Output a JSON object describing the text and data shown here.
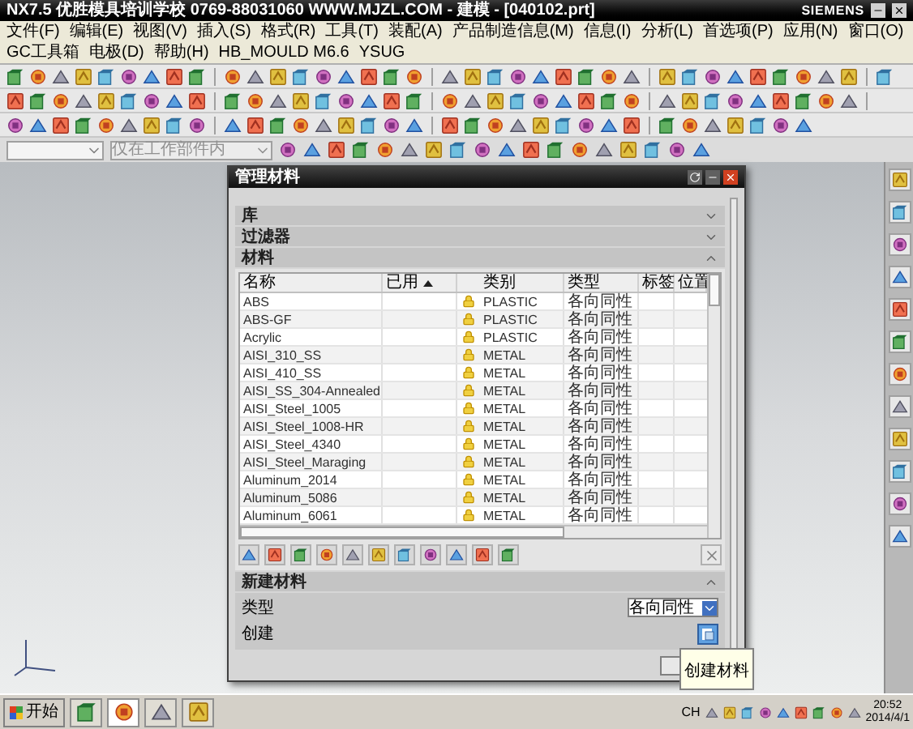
{
  "title_bar": {
    "title": "NX7.5  优胜模具培训学校  0769-88031060  WWW.MJZL.COM - 建模 - [040102.prt]",
    "brand": "SIEMENS"
  },
  "menu_bar": [
    "文件(F)",
    "编辑(E)",
    "视图(V)",
    "插入(S)",
    "格式(R)",
    "工具(T)",
    "装配(A)",
    "产品制造信息(M)",
    "信息(I)",
    "分析(L)",
    "首选项(P)",
    "应用(N)",
    "窗口(O)",
    "GC工具箱",
    "电极(D)",
    "帮助(H)",
    "HB_MOULD M6.6",
    "YSUG"
  ],
  "selection_bar": {
    "scope_dropdown": {
      "value": "仅在工作部件内",
      "disabled": true
    }
  },
  "dialog": {
    "title": "管理材料",
    "sections": [
      {
        "label": "库",
        "expanded": false
      },
      {
        "label": "过滤器",
        "expanded": false
      },
      {
        "label": "材料",
        "expanded": true
      }
    ],
    "table": {
      "columns": [
        {
          "kind": "text",
          "label": "名称",
          "sorted": false
        },
        {
          "kind": "text",
          "label": "已用",
          "sorted": true
        },
        {
          "kind": "icon"
        },
        {
          "kind": "text",
          "label": "类别",
          "sorted": false
        },
        {
          "kind": "text",
          "label": "类型",
          "sorted": false
        },
        {
          "kind": "text",
          "label": "标签",
          "sorted": false
        },
        {
          "kind": "text",
          "label": "位置",
          "sorted": false
        }
      ],
      "rows": [
        {
          "name": "ABS",
          "locked": true,
          "category": "PLASTIC",
          "type": "各向同性"
        },
        {
          "name": "ABS-GF",
          "locked": true,
          "category": "PLASTIC",
          "type": "各向同性"
        },
        {
          "name": "Acrylic",
          "locked": true,
          "category": "PLASTIC",
          "type": "各向同性"
        },
        {
          "name": "AISI_310_SS",
          "locked": true,
          "category": "METAL",
          "type": "各向同性"
        },
        {
          "name": "AISI_410_SS",
          "locked": true,
          "category": "METAL",
          "type": "各向同性"
        },
        {
          "name": "AISI_SS_304-Annealed",
          "locked": true,
          "category": "METAL",
          "type": "各向同性"
        },
        {
          "name": "AISI_Steel_1005",
          "locked": true,
          "category": "METAL",
          "type": "各向同性"
        },
        {
          "name": "AISI_Steel_1008-HR",
          "locked": true,
          "category": "METAL",
          "type": "各向同性"
        },
        {
          "name": "AISI_Steel_4340",
          "locked": true,
          "category": "METAL",
          "type": "各向同性"
        },
        {
          "name": "AISI_Steel_Maraging",
          "locked": true,
          "category": "METAL",
          "type": "各向同性"
        },
        {
          "name": "Aluminum_2014",
          "locked": true,
          "category": "METAL",
          "type": "各向同性"
        },
        {
          "name": "Aluminum_5086",
          "locked": true,
          "category": "METAL",
          "type": "各向同性"
        },
        {
          "name": "Aluminum_6061",
          "locked": true,
          "category": "METAL",
          "type": "各向同性"
        }
      ]
    },
    "new_material": {
      "label": "新建材料",
      "expanded": true,
      "type_label": "类型",
      "type_value": "各向同性",
      "create_label": "创建"
    },
    "tooltip": "创建材料"
  },
  "taskbar": {
    "start": "开始",
    "language": "CH",
    "time": "20:52",
    "date": "2014/4/1"
  }
}
